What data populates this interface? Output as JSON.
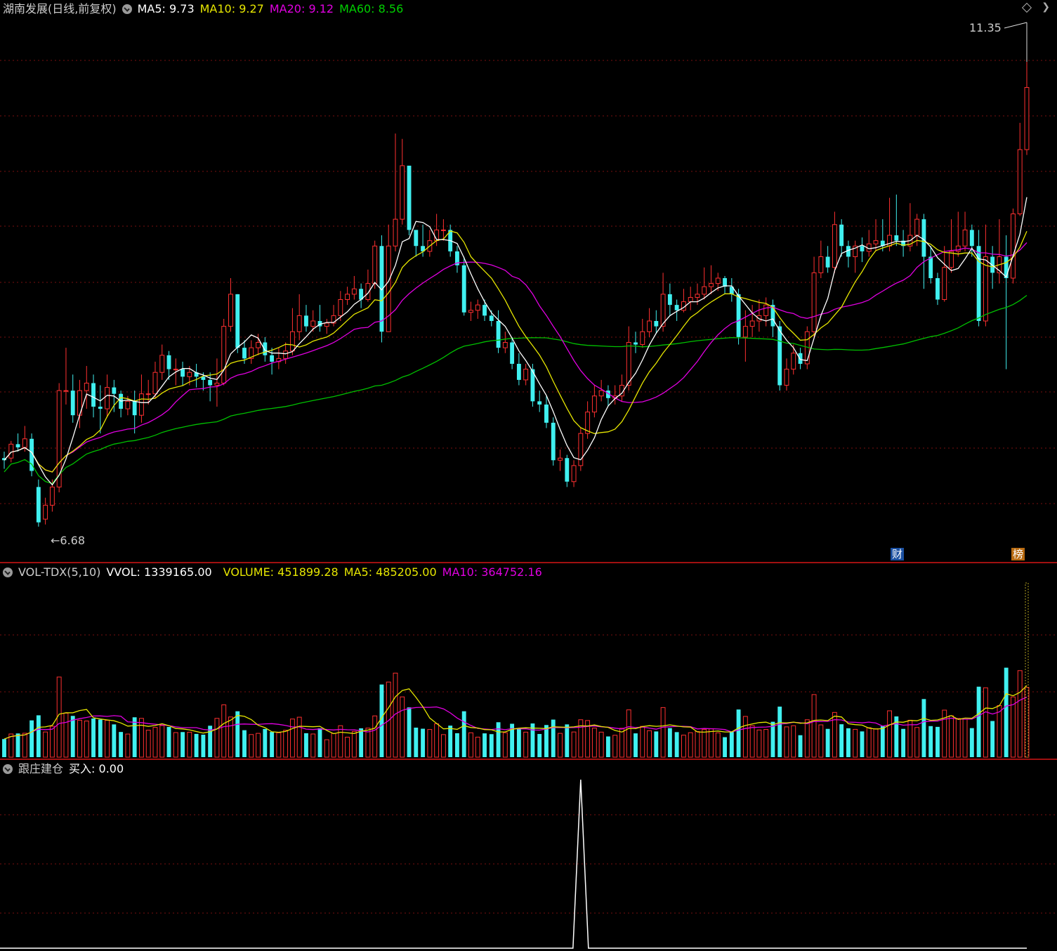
{
  "price": {
    "title": "湖南发展(日线,前复权)",
    "ma5_label": "MA5:",
    "ma5": "9.73",
    "ma10_label": "MA10:",
    "ma10": "9.27",
    "ma20_label": "MA20:",
    "ma20": "9.12",
    "ma60_label": "MA60:",
    "ma60": "8.56",
    "high_marker": "11.35",
    "low_marker": "←6.68",
    "badge_fin": "财",
    "badge_rank": "榜",
    "colors": {
      "ma5": "#ffffff",
      "ma10": "#e6e600",
      "ma20": "#e100e1",
      "ma60": "#00c000",
      "up": "#ff3030",
      "down": "#40f0f0"
    }
  },
  "volume": {
    "title": "VOL-TDX(5,10)",
    "vvol_label": "VVOL:",
    "vvol": "1339165.00",
    "volume_label": "VOLUME:",
    "volume": "451899.28",
    "ma5_label": "MA5:",
    "ma5": "485205.00",
    "ma10_label": "MA10:",
    "ma10": "364752.16"
  },
  "indicator": {
    "title": "跟庄建仓",
    "buy_label": "买入:",
    "buy": "0.00"
  },
  "chart_data": {
    "type": "candlestick",
    "price_range": [
      6.6,
      11.4
    ],
    "candles": [
      [
        7.32,
        7.3,
        7.38,
        7.22
      ],
      [
        7.32,
        7.45,
        7.48,
        7.28
      ],
      [
        7.45,
        7.42,
        7.55,
        7.38
      ],
      [
        7.42,
        7.5,
        7.62,
        7.38
      ],
      [
        7.5,
        7.2,
        7.55,
        7.15
      ],
      [
        7.05,
        6.72,
        7.12,
        6.68
      ],
      [
        6.75,
        6.88,
        6.95,
        6.7
      ],
      [
        6.88,
        7.05,
        7.12,
        6.82
      ],
      [
        7.05,
        7.95,
        8.02,
        7.0
      ],
      [
        7.95,
        7.95,
        8.35,
        7.82
      ],
      [
        7.95,
        7.72,
        8.1,
        7.65
      ],
      [
        7.72,
        7.95,
        8.05,
        7.6
      ],
      [
        7.95,
        8.02,
        8.18,
        7.78
      ],
      [
        8.02,
        7.8,
        8.1,
        7.7
      ],
      [
        7.8,
        7.78,
        8.0,
        7.55
      ],
      [
        7.78,
        7.98,
        8.1,
        7.7
      ],
      [
        7.98,
        7.92,
        8.05,
        7.75
      ],
      [
        7.92,
        7.78,
        7.95,
        7.7
      ],
      [
        7.78,
        7.85,
        7.9,
        7.72
      ],
      [
        7.85,
        7.72,
        7.95,
        7.55
      ],
      [
        7.72,
        7.92,
        8.1,
        7.65
      ],
      [
        7.92,
        7.92,
        8.05,
        7.82
      ],
      [
        7.92,
        8.12,
        8.22,
        7.88
      ],
      [
        8.12,
        8.28,
        8.38,
        8.05
      ],
      [
        8.28,
        8.15,
        8.32,
        8.05
      ],
      [
        8.15,
        8.15,
        8.25,
        8.0
      ],
      [
        8.15,
        8.08,
        8.22,
        8.0
      ],
      [
        8.08,
        8.12,
        8.18,
        8.0
      ],
      [
        8.12,
        8.08,
        8.2,
        7.98
      ],
      [
        8.08,
        8.05,
        8.12,
        7.95
      ],
      [
        8.05,
        8.0,
        8.12,
        7.85
      ],
      [
        8.0,
        8.02,
        8.25,
        7.8
      ],
      [
        8.02,
        8.55,
        8.62,
        8.0
      ],
      [
        8.55,
        8.85,
        9.0,
        8.5
      ],
      [
        8.85,
        8.35,
        8.85,
        8.3
      ],
      [
        8.35,
        8.25,
        8.42,
        8.2
      ],
      [
        8.25,
        8.35,
        8.42,
        8.2
      ],
      [
        8.35,
        8.4,
        8.48,
        8.28
      ],
      [
        8.4,
        8.28,
        8.45,
        8.22
      ],
      [
        8.28,
        8.22,
        8.35,
        8.1
      ],
      [
        8.22,
        8.25,
        8.35,
        8.15
      ],
      [
        8.25,
        8.32,
        8.4,
        8.2
      ],
      [
        8.32,
        8.5,
        8.72,
        8.28
      ],
      [
        8.5,
        8.65,
        8.85,
        8.42
      ],
      [
        8.65,
        8.55,
        8.75,
        8.5
      ],
      [
        8.55,
        8.6,
        8.7,
        8.5
      ],
      [
        8.6,
        8.55,
        8.75,
        8.5
      ],
      [
        8.55,
        8.58,
        8.62,
        8.48
      ],
      [
        8.58,
        8.65,
        8.75,
        8.55
      ],
      [
        8.65,
        8.8,
        8.88,
        8.6
      ],
      [
        8.8,
        8.85,
        8.92,
        8.75
      ],
      [
        8.85,
        8.9,
        9.02,
        8.8
      ],
      [
        8.9,
        8.8,
        8.95,
        8.72
      ],
      [
        8.8,
        8.95,
        9.08,
        8.78
      ],
      [
        8.95,
        9.3,
        9.35,
        8.9
      ],
      [
        9.3,
        8.5,
        9.4,
        8.4
      ],
      [
        8.5,
        9.3,
        9.5,
        8.5
      ],
      [
        9.3,
        9.55,
        10.35,
        9.25
      ],
      [
        9.55,
        10.05,
        10.3,
        9.5
      ],
      [
        10.05,
        9.45,
        10.0,
        9.4
      ],
      [
        9.45,
        9.3,
        9.45,
        9.2
      ],
      [
        9.3,
        9.25,
        9.5,
        9.2
      ],
      [
        9.25,
        9.35,
        9.45,
        9.2
      ],
      [
        9.35,
        9.45,
        9.6,
        9.3
      ],
      [
        9.45,
        9.45,
        9.55,
        9.35
      ],
      [
        9.45,
        9.25,
        9.5,
        9.2
      ],
      [
        9.25,
        9.12,
        9.3,
        9.05
      ],
      [
        9.12,
        8.68,
        9.2,
        8.65
      ],
      [
        8.68,
        8.7,
        8.78,
        8.6
      ],
      [
        8.7,
        8.75,
        8.8,
        8.62
      ],
      [
        8.75,
        8.65,
        8.8,
        8.6
      ],
      [
        8.65,
        8.6,
        8.7,
        8.55
      ],
      [
        8.6,
        8.35,
        8.7,
        8.3
      ],
      [
        8.35,
        8.4,
        8.5,
        8.3
      ],
      [
        8.4,
        8.2,
        8.45,
        8.15
      ],
      [
        8.2,
        8.05,
        8.3,
        8.0
      ],
      [
        8.05,
        8.15,
        8.2,
        8.0
      ],
      [
        8.15,
        7.85,
        8.2,
        7.8
      ],
      [
        7.85,
        7.82,
        7.95,
        7.75
      ],
      [
        7.82,
        7.65,
        7.9,
        7.6
      ],
      [
        7.65,
        7.3,
        7.7,
        7.25
      ],
      [
        7.3,
        7.32,
        7.4,
        7.2
      ],
      [
        7.32,
        7.1,
        7.35,
        7.05
      ],
      [
        7.1,
        7.25,
        7.3,
        7.05
      ],
      [
        7.25,
        7.55,
        7.6,
        7.2
      ],
      [
        7.55,
        7.75,
        7.85,
        7.5
      ],
      [
        7.75,
        7.9,
        8.0,
        7.7
      ],
      [
        7.9,
        7.95,
        8.05,
        7.85
      ],
      [
        7.95,
        7.88,
        8.0,
        7.8
      ],
      [
        7.88,
        7.9,
        8.0,
        7.82
      ],
      [
        7.9,
        8.0,
        8.1,
        7.85
      ],
      [
        8.0,
        8.4,
        8.55,
        7.95
      ],
      [
        8.4,
        8.38,
        8.5,
        8.3
      ],
      [
        8.38,
        8.5,
        8.62,
        8.35
      ],
      [
        8.5,
        8.6,
        8.72,
        8.45
      ],
      [
        8.6,
        8.55,
        8.7,
        8.48
      ],
      [
        8.55,
        8.85,
        9.05,
        8.5
      ],
      [
        8.85,
        8.75,
        8.95,
        8.65
      ],
      [
        8.75,
        8.7,
        8.8,
        8.6
      ],
      [
        8.7,
        8.78,
        8.9,
        8.68
      ],
      [
        8.78,
        8.82,
        8.92,
        8.7
      ],
      [
        8.82,
        8.85,
        8.95,
        8.75
      ],
      [
        8.85,
        8.92,
        9.1,
        8.8
      ],
      [
        8.92,
        8.95,
        9.12,
        8.85
      ],
      [
        8.95,
        9.0,
        9.05,
        8.88
      ],
      [
        9.0,
        8.92,
        9.02,
        8.85
      ],
      [
        8.92,
        8.85,
        9.0,
        8.78
      ],
      [
        8.85,
        8.45,
        8.9,
        8.38
      ],
      [
        8.45,
        8.55,
        8.7,
        8.22
      ],
      [
        8.55,
        8.6,
        8.75,
        8.45
      ],
      [
        8.6,
        8.65,
        8.8,
        8.5
      ],
      [
        8.65,
        8.75,
        8.82,
        8.55
      ],
      [
        8.75,
        8.55,
        8.8,
        8.45
      ],
      [
        8.55,
        8.0,
        8.6,
        7.95
      ],
      [
        8.0,
        8.15,
        8.25,
        7.95
      ],
      [
        8.15,
        8.3,
        8.38,
        8.1
      ],
      [
        8.3,
        8.2,
        8.35,
        8.15
      ],
      [
        8.2,
        8.5,
        8.55,
        8.15
      ],
      [
        8.5,
        9.05,
        9.2,
        8.45
      ],
      [
        9.05,
        9.2,
        9.35,
        9.0
      ],
      [
        9.2,
        9.1,
        9.3,
        9.05
      ],
      [
        9.1,
        9.5,
        9.62,
        9.05
      ],
      [
        9.5,
        9.3,
        9.55,
        9.2
      ],
      [
        9.3,
        9.2,
        9.35,
        9.1
      ],
      [
        9.2,
        9.3,
        9.35,
        9.05
      ],
      [
        9.3,
        9.25,
        9.38,
        9.15
      ],
      [
        9.25,
        9.32,
        9.45,
        9.2
      ],
      [
        9.32,
        9.35,
        9.55,
        9.25
      ],
      [
        9.35,
        9.3,
        9.55,
        9.25
      ],
      [
        9.3,
        9.4,
        9.75,
        9.25
      ],
      [
        9.4,
        9.35,
        9.78,
        9.3
      ],
      [
        9.35,
        9.3,
        9.45,
        9.2
      ],
      [
        9.3,
        9.4,
        9.7,
        9.25
      ],
      [
        9.4,
        9.55,
        9.6,
        9.3
      ],
      [
        9.55,
        9.2,
        9.6,
        8.9
      ],
      [
        9.2,
        9.0,
        9.3,
        8.95
      ],
      [
        9.0,
        8.8,
        9.05,
        8.75
      ],
      [
        8.8,
        9.1,
        9.3,
        8.78
      ],
      [
        9.1,
        9.25,
        9.55,
        9.05
      ],
      [
        9.25,
        9.3,
        9.62,
        9.2
      ],
      [
        9.3,
        9.45,
        9.62,
        9.25
      ],
      [
        9.45,
        9.3,
        9.5,
        9.2
      ],
      [
        9.3,
        8.6,
        9.45,
        8.55
      ],
      [
        8.6,
        9.2,
        9.5,
        8.55
      ],
      [
        9.2,
        9.05,
        9.3,
        8.9
      ],
      [
        9.05,
        9.2,
        9.55,
        8.95
      ],
      [
        9.2,
        9.0,
        9.4,
        8.15
      ],
      [
        9.0,
        9.6,
        9.65,
        8.95
      ],
      [
        9.6,
        10.2,
        10.45,
        9.58
      ],
      [
        10.2,
        10.78,
        11.35,
        10.15
      ]
    ],
    "ma5_last": 9.73,
    "ma10_last": 9.27,
    "ma20_last": 9.12,
    "ma60_last": 8.56
  }
}
